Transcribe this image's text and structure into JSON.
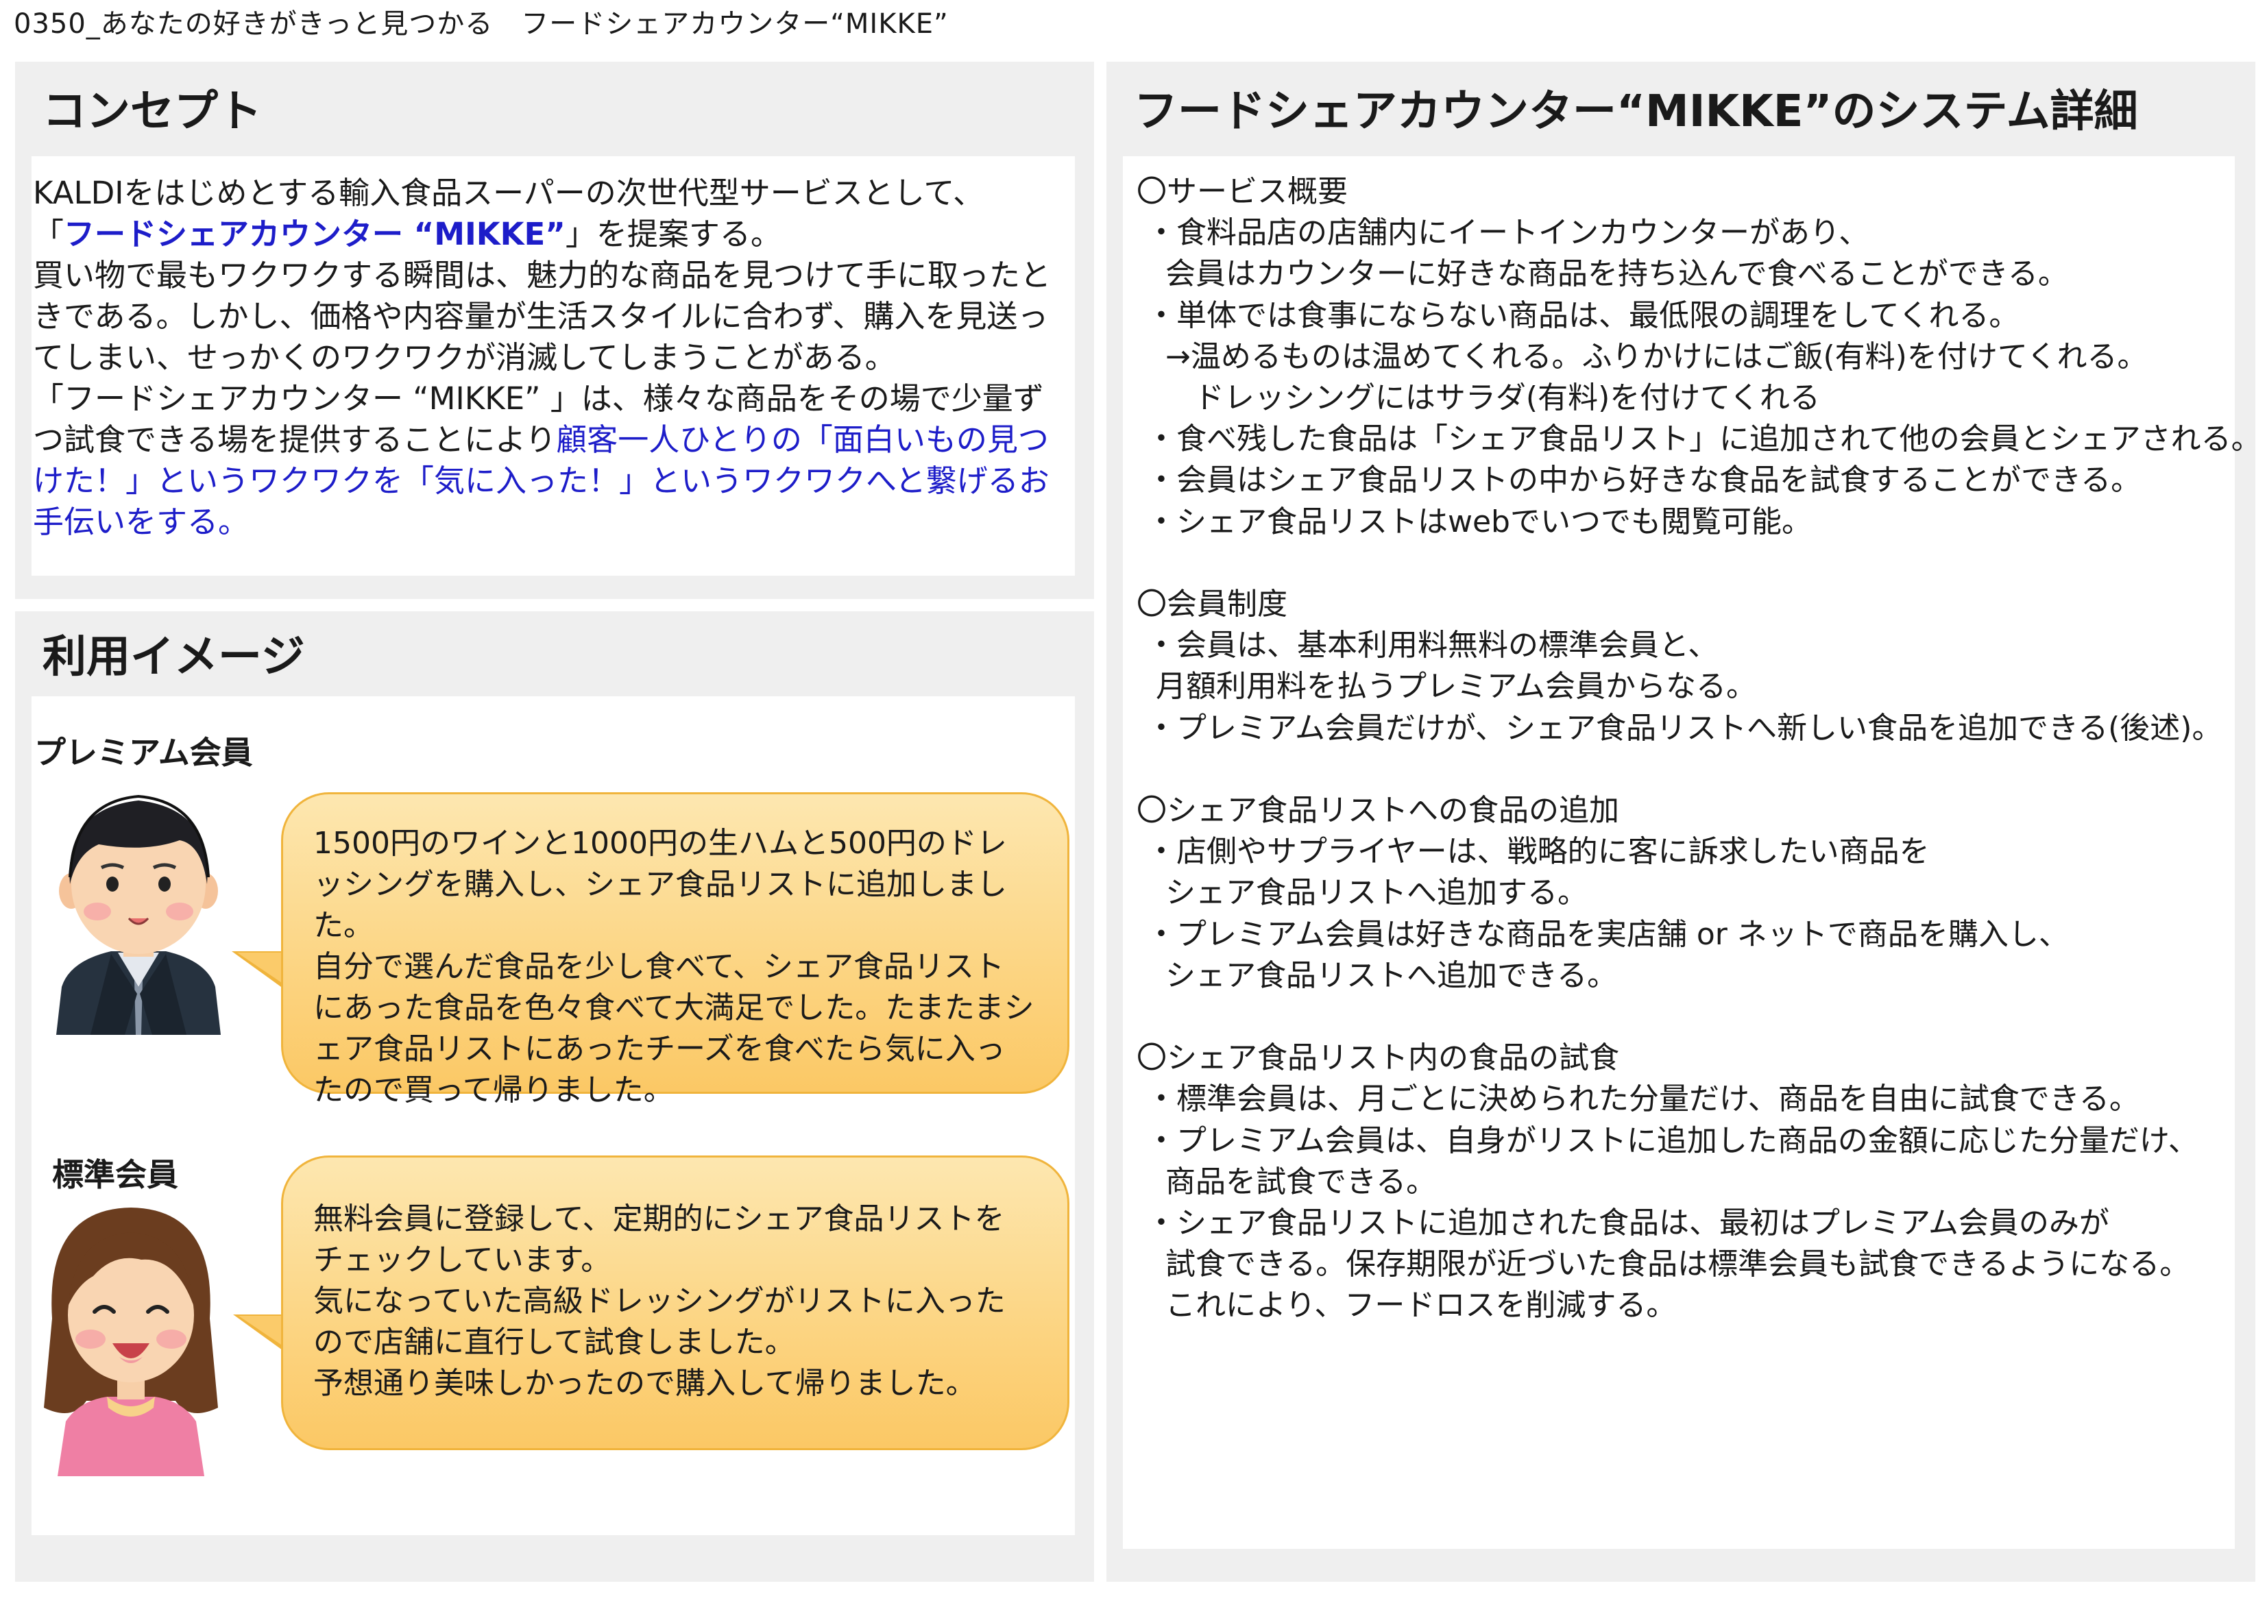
{
  "document_title": "0350_あなたの好きがきっと見つかる　フードシェアカウンター“MIKKE”",
  "concept": {
    "heading": "コンセプト",
    "line1": "KALDIをはじめとする輸入食品スーパーの次世代型サービスとして、",
    "line2_open": "「",
    "line2_name": "フードシェアカウンター “MIKKE”",
    "line2_close": "」を提案する。",
    "para2": "買い物で最もワクワクする瞬間は、魅力的な商品を見つけて手に取ったときである。しかし、価格や内容量が生活スタイルに合わず、購入を見送ってしまい、せっかくのワクワクが消滅してしまうことがある。",
    "para3_plain": "「フードシェアカウンター “MIKKE” 」は、様々な商品をその場で少量ずつ試食できる場を提供することにより",
    "para3_blue": "顧客一人ひとりの「面白いもの見つけた！」というワクワクを「気に入った！」というワクワクへと繋げるお手伝いをする。"
  },
  "usage": {
    "heading": "利用イメージ",
    "premium": {
      "role": "プレミアム会員",
      "bubble": [
        "1500円のワインと1000円の生ハムと500円のドレッシングを購入し、シェア食品リストに追加しました。",
        "自分で選んだ食品を少し食べて、シェア食品リストにあった食品を色々食べて大満足でした。たまたまシェア食品リストにあったチーズを食べたら気に入ったので買って帰りました。"
      ]
    },
    "standard": {
      "role": "標準会員",
      "bubble": [
        "無料会員に登録して、定期的にシェア食品リストをチェックしています。",
        "気になっていた高級ドレッシングがリストに入ったので店舗に直行して試食しました。",
        "予想通り美味しかったので購入して帰りました。"
      ]
    }
  },
  "system": {
    "heading": "フードシェアカウンター“MIKKE”のシステム詳細",
    "text": "〇サービス概要\n ・食料品店の店舗内にイートインカウンターがあり、\n   会員はカウンターに好きな商品を持ち込んで食べることができる。\n ・単体では食事にならない商品は、最低限の調理をしてくれる。\n   →温めるものは温めてくれる。ふりかけにはご飯(有料)を付けてくれる。\n      ドレッシングにはサラダ(有料)を付けてくれる\n ・食べ残した食品は「シェア食品リスト」に追加されて他の会員とシェアされる。\n ・会員はシェア食品リストの中から好きな食品を試食することができる。\n ・シェア食品リストはwebでいつでも閲覧可能。\n\n〇会員制度\n ・会員は、基本利用料無料の標準会員と、\n  月額利用料を払うプレミアム会員からなる。\n ・プレミアム会員だけが、シェア食品リストへ新しい食品を追加できる(後述)。\n\n〇シェア食品リストへの食品の追加\n ・店側やサプライヤーは、戦略的に客に訴求したい商品を\n   シェア食品リストへ追加する。\n ・プレミアム会員は好きな商品を実店舗 or ネットで商品を購入し、\n   シェア食品リストへ追加できる。\n\n〇シェア食品リスト内の食品の試食\n ・標準会員は、月ごとに決められた分量だけ、商品を自由に試食できる。\n ・プレミアム会員は、自身がリストに追加した商品の金額に応じた分量だけ、\n   商品を試食できる。\n ・シェア食品リストに追加された食品は、最初はプレミアム会員のみが\n   試食できる。保存期限が近づいた食品は標準会員も試食できるようになる。\n   これにより、フードロスを削減する。"
  }
}
